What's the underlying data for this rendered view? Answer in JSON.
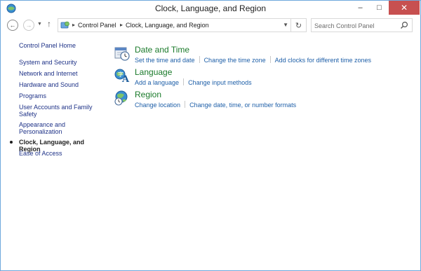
{
  "window": {
    "title": "Clock, Language, and Region",
    "minimize_label": "–",
    "maximize_label": "□",
    "close_label": "✕"
  },
  "navigation": {
    "back_label": "←",
    "forward_label": "→",
    "recent_label": "▼",
    "up_label": "↑",
    "chevron": "▸",
    "breadcrumbs": [
      "Control Panel",
      "Clock, Language, and Region"
    ],
    "dropdown_label": "▼",
    "refresh_label": "↻"
  },
  "search": {
    "placeholder": "Search Control Panel"
  },
  "sidebar": {
    "items": [
      {
        "label": "Control Panel Home"
      },
      {
        "label": "System and Security"
      },
      {
        "label": "Network and Internet"
      },
      {
        "label": "Hardware and Sound"
      },
      {
        "label": "Programs"
      },
      {
        "label": "User Accounts and Family Safety"
      },
      {
        "label": "Appearance and Personalization"
      },
      {
        "label": "Clock, Language, and Region"
      },
      {
        "label": "Ease of Access"
      }
    ]
  },
  "categories": [
    {
      "title": "Date and Time",
      "icon": "clock-calendar-icon",
      "links": [
        "Set the time and date",
        "Change the time zone",
        "Add clocks for different time zones"
      ]
    },
    {
      "title": "Language",
      "icon": "language-icon",
      "links": [
        "Add a language",
        "Change input methods"
      ]
    },
    {
      "title": "Region",
      "icon": "globe-clock-icon",
      "links": [
        "Change location",
        "Change date, time, or number formats"
      ]
    }
  ],
  "colors": {
    "category_title": "#1a7a2a",
    "link": "#1e5fa8",
    "nav_link": "#1e3287",
    "close_button": "#c75050"
  }
}
